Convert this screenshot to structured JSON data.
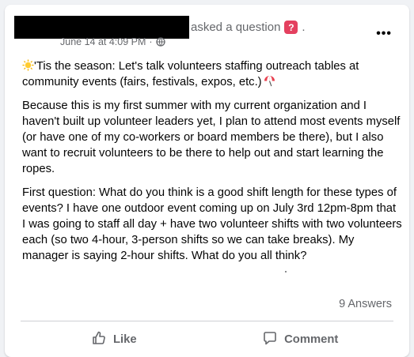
{
  "post": {
    "action_text": "asked a question",
    "question_badge": "?",
    "trailing_punct": ".",
    "timestamp": "June 14 at 4:09 PM",
    "separator": "·",
    "more_label": "•••",
    "paragraph1": "'Tis the season: Let's talk volunteers staffing outreach tables at community events (fairs, festivals, expos, etc.)",
    "paragraph2": "Because this is my first summer with my current organization and I haven't built up volunteer leaders yet, I plan to attend most events myself (or have one of my co-workers or board members be there), but I also want to recruit volunteers to be there to help out and start learning the ropes.",
    "paragraph3": "First question: What do you think is a good shift length for these types of events? I have one outdoor event coming up on July 3rd 12pm-8pm that I was going to staff all day + have two volunteer shifts with two volunteers each (so two 4-hour, 3-person shifts so we can take breaks). My manager is saying 2-hour shifts. What do you all think?"
  },
  "footer": {
    "answers": "9 Answers",
    "like_label": "Like",
    "comment_label": "Comment"
  },
  "icons": {
    "question": "question-mark-icon",
    "privacy": "globe-icon",
    "more": "more-options-icon",
    "sun": "sun-icon",
    "umbrella": "beach-umbrella-icon",
    "like": "thumbs-up-icon",
    "comment": "comment-icon"
  },
  "colors": {
    "text": "#050505",
    "secondary": "#65676b",
    "question_badge": "#e4405f",
    "background": "#f0f2f5",
    "card": "#ffffff"
  }
}
